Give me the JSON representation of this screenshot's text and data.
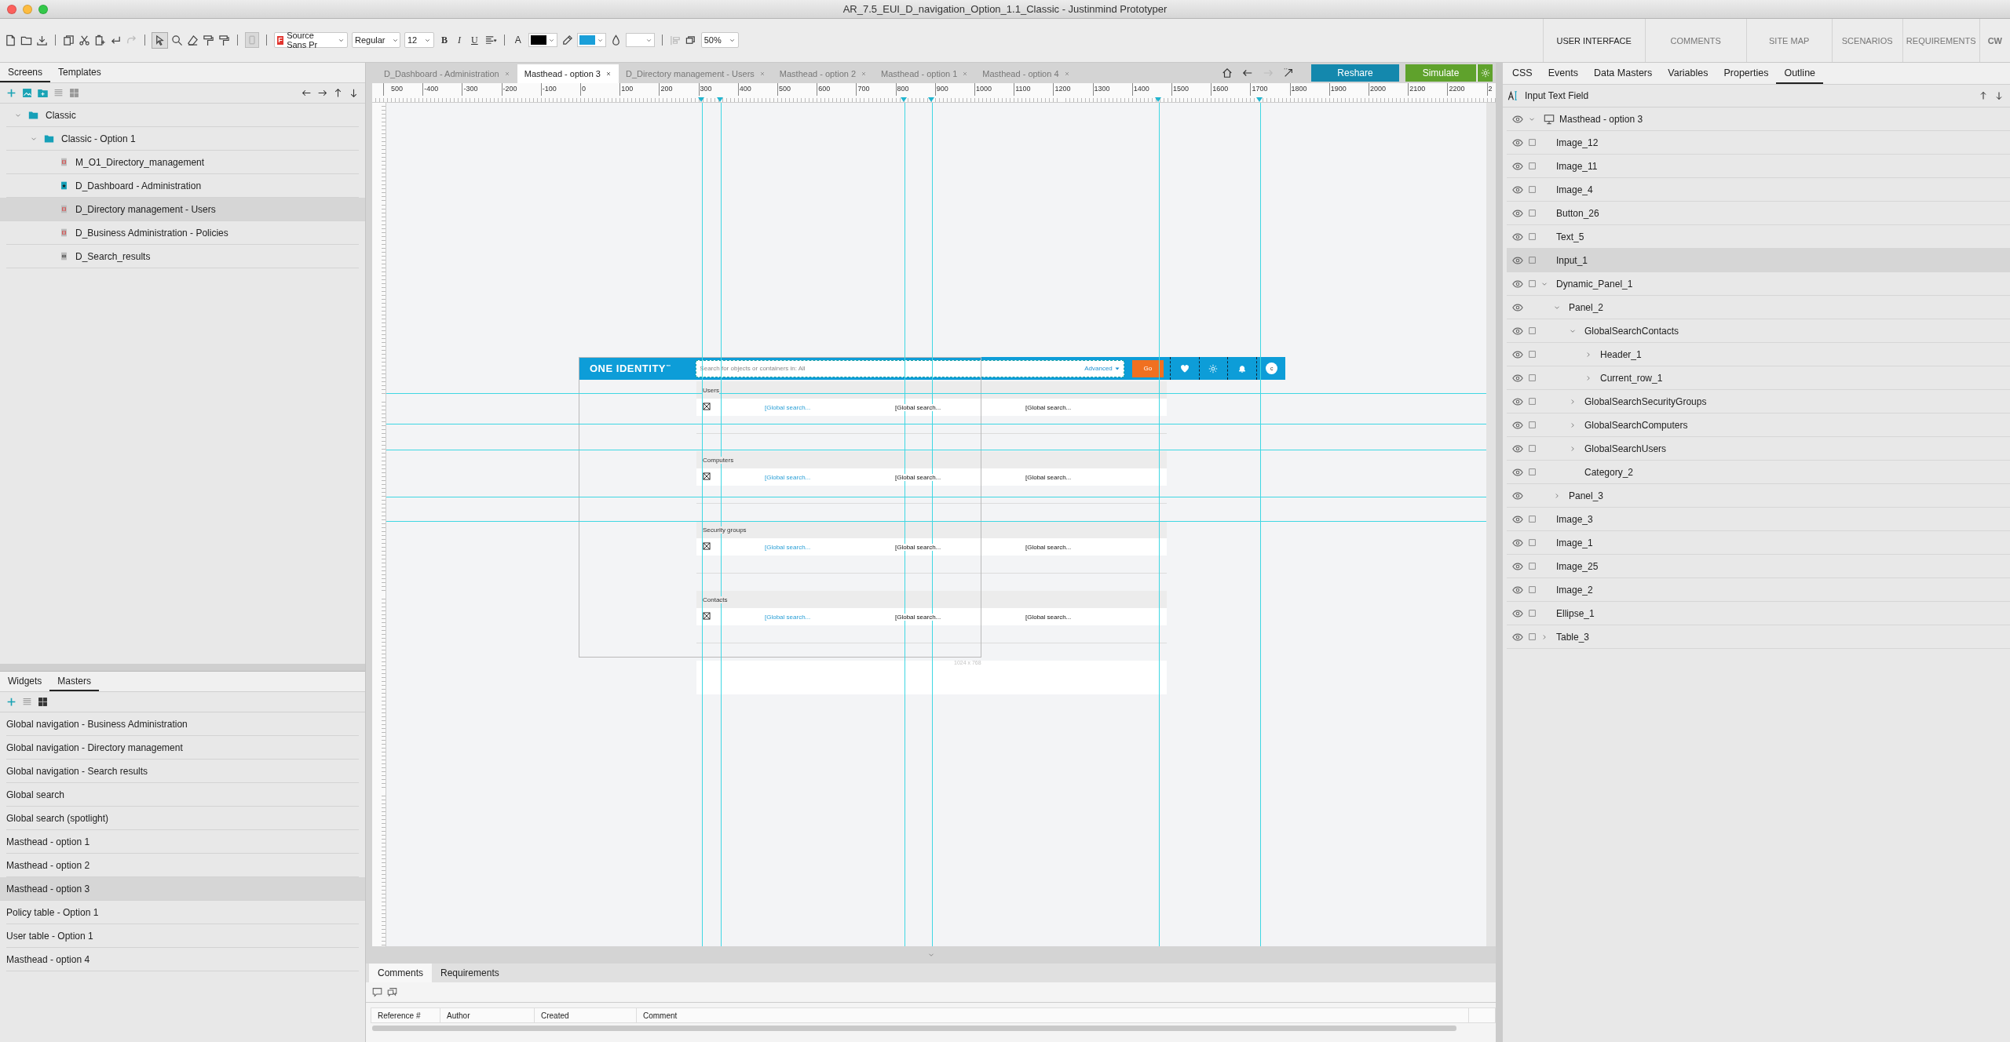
{
  "window": {
    "title": "AR_7.5_EUI_D_navigation_Option_1.1_Classic - Justinmind Prototyper"
  },
  "toolbar": {
    "font_badge": "F",
    "font": "Source Sans Pr",
    "weight": "Regular",
    "size": "12",
    "bold": "B",
    "italic": "I",
    "underline": "U",
    "text_label": "A",
    "zoom": "50%",
    "color_pickers": [
      {
        "color": "#000000"
      },
      {
        "color": "#1a9fd9"
      },
      {
        "color": "#ffffff"
      }
    ]
  },
  "perspectives": [
    {
      "label": "USER INTERFACE",
      "selected": true
    },
    {
      "label": "COMMENTS",
      "selected": false
    },
    {
      "label": "SITE MAP",
      "selected": false
    },
    {
      "label": "SCENARIOS",
      "selected": false
    },
    {
      "label": "REQUIREMENTS",
      "selected": false
    }
  ],
  "user_badge": "CW",
  "screen_tabs": [
    {
      "label": "Screens",
      "selected": true
    },
    {
      "label": "Templates",
      "selected": false
    }
  ],
  "screens": [
    {
      "label": "Classic",
      "kind": "folder",
      "expanded": true,
      "selected": false,
      "children": [
        {
          "label": "Classic - Option 1",
          "kind": "folder",
          "expanded": true,
          "selected": false,
          "children": [
            {
              "label": "M_O1_Directory_management",
              "kind": "page",
              "selected": false
            },
            {
              "label": "D_Dashboard - Administration",
              "kind": "home-page",
              "selected": false
            },
            {
              "label": "D_Directory management - Users",
              "kind": "page",
              "selected": true
            },
            {
              "label": "D_Business Administration - Policies",
              "kind": "page",
              "selected": false
            },
            {
              "label": "D_Search_results",
              "kind": "plain-page",
              "selected": false
            }
          ]
        }
      ]
    }
  ],
  "widget_tabs": [
    {
      "label": "Widgets",
      "selected": false
    },
    {
      "label": "Masters",
      "selected": true
    }
  ],
  "masters": [
    {
      "label": "Global navigation - Business Administration",
      "selected": false
    },
    {
      "label": "Global navigation - Directory management",
      "selected": false
    },
    {
      "label": "Global navigation - Search results",
      "selected": false
    },
    {
      "label": "Global search",
      "selected": false
    },
    {
      "label": "Global search (spotlight)",
      "selected": false
    },
    {
      "label": "Masthead - option 1",
      "selected": false
    },
    {
      "label": "Masthead - option 2",
      "selected": false
    },
    {
      "label": "Masthead - option 3",
      "selected": true
    },
    {
      "label": "Policy table - Option 1",
      "selected": false
    },
    {
      "label": "User table - Option 1",
      "selected": false
    },
    {
      "label": "Masthead - option 4",
      "selected": false
    }
  ],
  "doc_tabs": [
    {
      "label": "D_Dashboard - Administration",
      "selected": false
    },
    {
      "label": "Masthead - option 3",
      "selected": true
    },
    {
      "label": "D_Directory management - Users",
      "selected": false
    },
    {
      "label": "Masthead - option 2",
      "selected": false
    },
    {
      "label": "Masthead - option 1",
      "selected": false
    },
    {
      "label": "Masthead - option 4",
      "selected": false
    }
  ],
  "reshare_button": "Reshare",
  "simulate_button": "Simulate",
  "ruler": [
    "500",
    "-400",
    "-300",
    "-200",
    "-100",
    "0",
    "100",
    "200",
    "300",
    "400",
    "500",
    "600",
    "700",
    "800",
    "900",
    "1000",
    "1100",
    "1200",
    "1300",
    "1400",
    "1500",
    "1600",
    "1700",
    "1800",
    "1900",
    "2000",
    "2100",
    "2200",
    "2"
  ],
  "mockup": {
    "logo": "ONE IDENTITY$^{™}$",
    "search_placeholder": "Search for objects or containers in: All",
    "advanced": "Advanced",
    "go": "Go",
    "avatar": "c",
    "frame_size": "1024 x 768",
    "sections": [
      {
        "category": "Users",
        "cells": [
          "[Global search...",
          "[Global search...",
          "[Global search..."
        ]
      },
      {
        "category": "Computers",
        "cells": [
          "[Global search...",
          "[Global search...",
          "[Global search..."
        ]
      },
      {
        "category": "Security groups",
        "cells": [
          "[Global search...",
          "[Global search...",
          "[Global search..."
        ]
      },
      {
        "category": "Contacts",
        "cells": [
          "[Global search...",
          "[Global search...",
          "[Global search..."
        ]
      }
    ]
  },
  "bottom_tabs": [
    {
      "label": "Comments",
      "selected": true
    },
    {
      "label": "Requirements",
      "selected": false
    }
  ],
  "comment_columns": [
    "Reference #",
    "Author",
    "Created",
    "Comment"
  ],
  "right_tabs": [
    {
      "label": "CSS",
      "selected": false
    },
    {
      "label": "Events",
      "selected": false
    },
    {
      "label": "Data Masters",
      "selected": false
    },
    {
      "label": "Variables",
      "selected": false
    },
    {
      "label": "Properties",
      "selected": false
    },
    {
      "label": "Outline",
      "selected": true
    }
  ],
  "outline": {
    "header": "Input Text Field",
    "items": [
      {
        "label": "Masthead - option 3",
        "kind": "screen",
        "expanded": true,
        "selected": false,
        "children": [
          {
            "label": "Image_12",
            "kind": "layer",
            "checked": false,
            "selected": false
          },
          {
            "label": "Image_11",
            "kind": "layer",
            "checked": false,
            "selected": false
          },
          {
            "label": "Image_4",
            "kind": "layer",
            "checked": false,
            "selected": false
          },
          {
            "label": "Button_26",
            "kind": "layer",
            "checked": false,
            "selected": false
          },
          {
            "label": "Text_5",
            "kind": "layer",
            "checked": false,
            "selected": false
          },
          {
            "label": "Input_1",
            "kind": "layer",
            "checked": false,
            "selected": true
          },
          {
            "label": "Dynamic_Panel_1",
            "kind": "layer",
            "checked": false,
            "expanded": true,
            "selected": false,
            "children": [
              {
                "label": "Panel_2",
                "kind": "panel",
                "expanded": true,
                "selected": false,
                "children": [
                  {
                    "label": "GlobalSearchContacts",
                    "kind": "layer",
                    "checked": false,
                    "expanded": true,
                    "selected": false,
                    "children": [
                      {
                        "label": "Header_1",
                        "kind": "layer",
                        "checked": false,
                        "expanded": false,
                        "selected": false
                      },
                      {
                        "label": "Current_row_1",
                        "kind": "layer",
                        "checked": false,
                        "expanded": false,
                        "selected": false
                      }
                    ]
                  },
                  {
                    "label": "GlobalSearchSecurityGroups",
                    "kind": "layer",
                    "checked": false,
                    "expanded": false,
                    "selected": false
                  },
                  {
                    "label": "GlobalSearchComputers",
                    "kind": "layer",
                    "checked": false,
                    "expanded": false,
                    "selected": false
                  },
                  {
                    "label": "GlobalSearchUsers",
                    "kind": "layer",
                    "checked": false,
                    "expanded": false,
                    "selected": false
                  },
                  {
                    "label": "Category_2",
                    "kind": "layer",
                    "checked": false,
                    "selected": false
                  }
                ]
              },
              {
                "label": "Panel_3",
                "kind": "panel",
                "expanded": false,
                "selected": false
              }
            ]
          },
          {
            "label": "Image_3",
            "kind": "layer",
            "checked": false,
            "selected": false
          },
          {
            "label": "Image_1",
            "kind": "layer",
            "checked": false,
            "selected": false
          },
          {
            "label": "Image_25",
            "kind": "layer",
            "checked": false,
            "selected": false
          },
          {
            "label": "Image_2",
            "kind": "layer",
            "checked": false,
            "selected": false
          },
          {
            "label": "Ellipse_1",
            "kind": "layer",
            "checked": false,
            "selected": false
          },
          {
            "label": "Table_3",
            "kind": "layer",
            "checked": false,
            "expanded": false,
            "selected": false
          }
        ]
      }
    ]
  }
}
